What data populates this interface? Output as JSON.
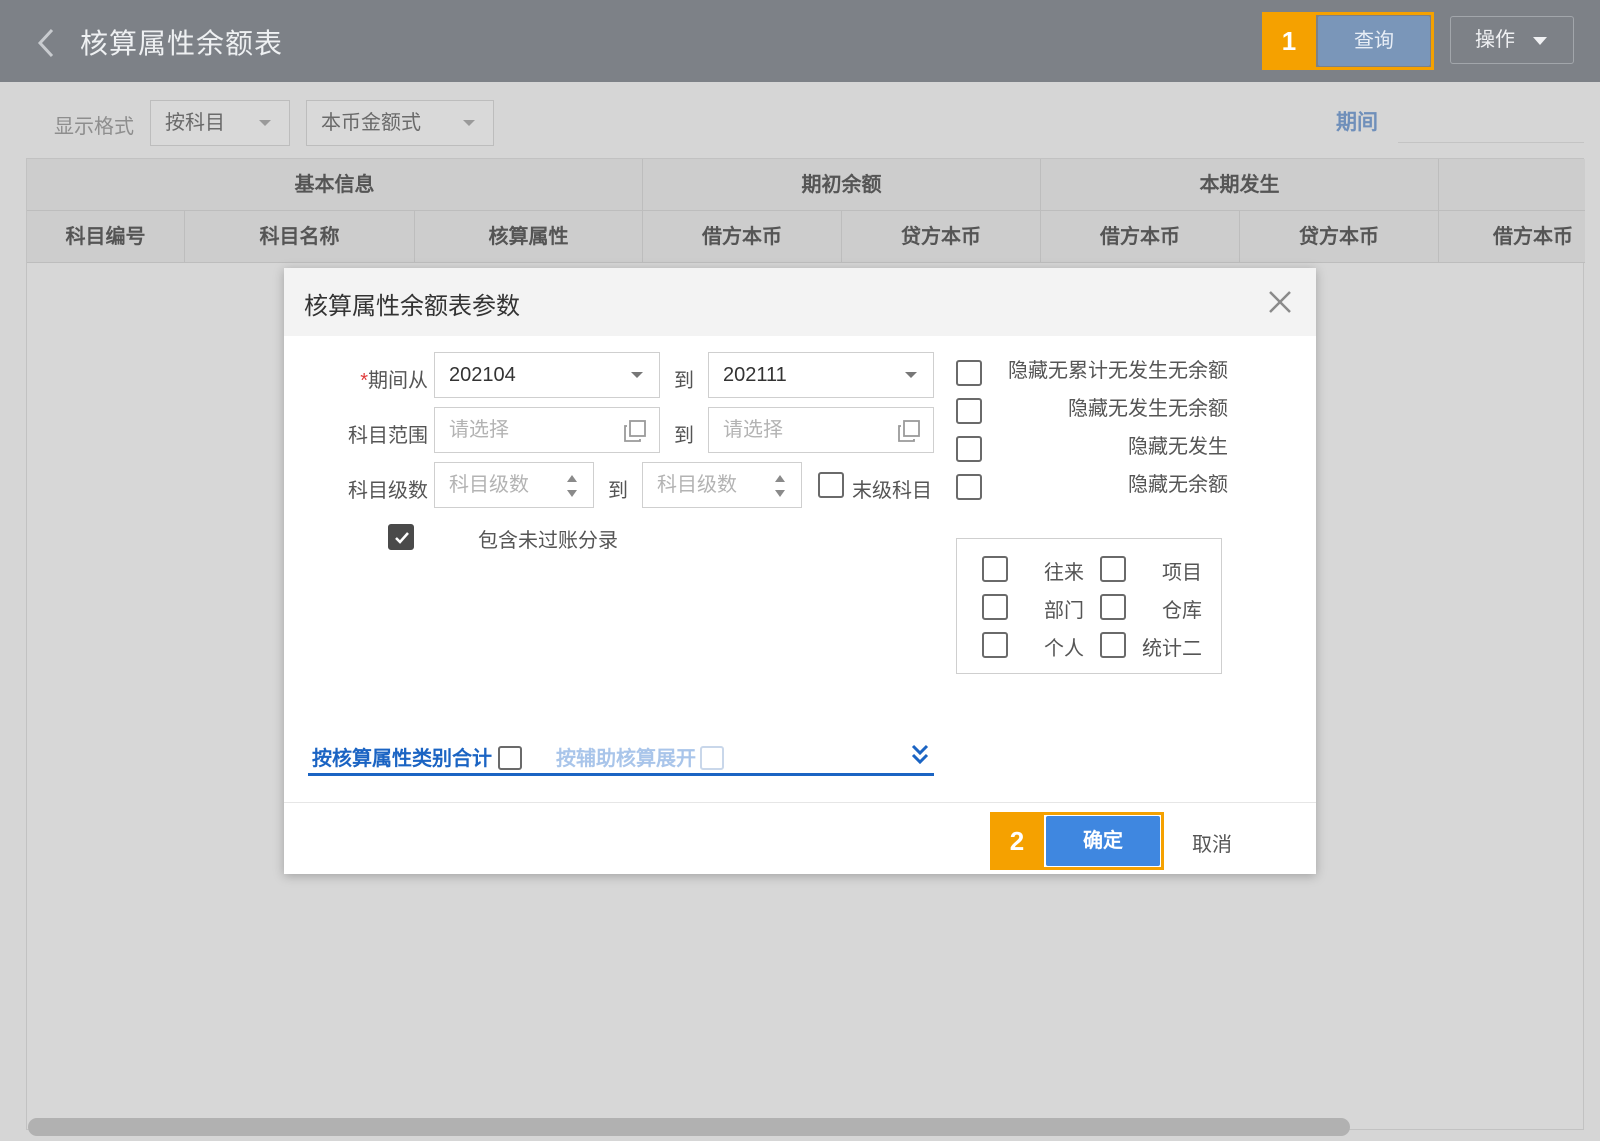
{
  "header": {
    "title": "核算属性余额表",
    "query_label": "查询",
    "ops_label": "操作",
    "badge_1": "1"
  },
  "filters": {
    "format_label": "显示格式",
    "by_subject": "按科目",
    "currency_format": "本币金额式",
    "period_label": "期间"
  },
  "table": {
    "groups": [
      "基本信息",
      "期初余额",
      "本期发生"
    ],
    "columns": [
      "科目编号",
      "科目名称",
      "核算属性",
      "借方本币",
      "贷方本币",
      "借方本币",
      "贷方本币",
      "借方本币"
    ]
  },
  "dialog": {
    "title": "核算属性余额表参数",
    "required_mark": "*",
    "period_from_label": "期间从",
    "period_from": "202104",
    "to": "到",
    "period_to": "202111",
    "subject_range_label": "科目范围",
    "select_placeholder": "请选择",
    "subject_level_label": "科目级数",
    "level_placeholder": "科目级数",
    "leaf_subject": "末级科目",
    "include_unposted": "包含未过账分录",
    "include_unposted_checked": true,
    "hide_options": [
      "隐藏无累计无发生无余额",
      "隐藏无发生无余额",
      "隐藏无发生",
      "隐藏无余额"
    ],
    "aux_items": [
      "往来",
      "项目",
      "部门",
      "仓库",
      "个人",
      "统计二"
    ],
    "tab_by_category": "按核算属性类别合计",
    "tab_by_aux": "按辅助核算展开",
    "ok_label": "确定",
    "cancel_label": "取消",
    "badge_2": "2"
  },
  "colors": {
    "accent": "#3f87e0",
    "highlight": "#f5a100",
    "header_bg": "#7d8187"
  }
}
